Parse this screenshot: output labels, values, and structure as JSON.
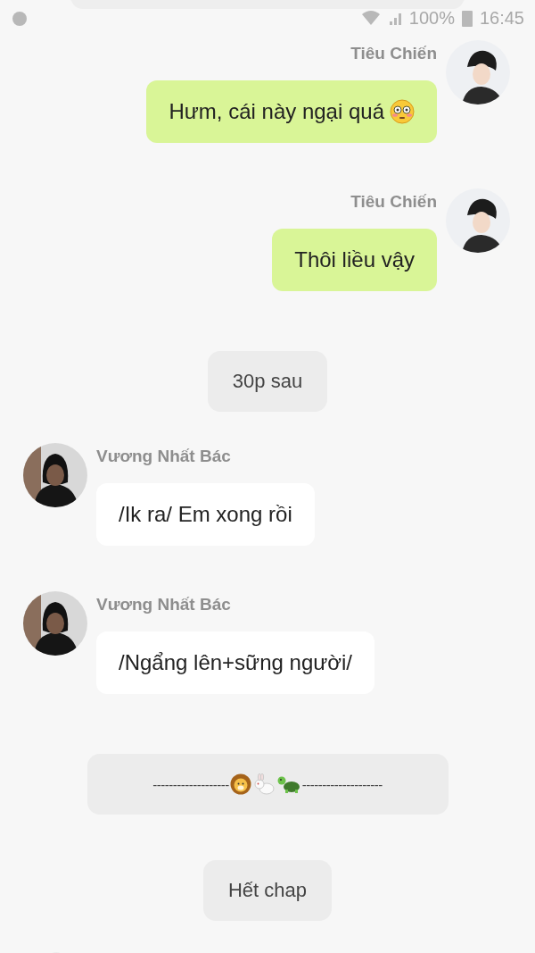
{
  "status_bar": {
    "battery": "100%",
    "time": "16:45"
  },
  "items": [
    {
      "kind": "sent",
      "sender": "Tiêu Chiến",
      "text": "Hưm, cái này ngại quá",
      "trailing_emoji": true
    },
    {
      "kind": "sent",
      "sender": "Tiêu Chiến",
      "text": "Thôi liều vậy",
      "trailing_emoji": false
    },
    {
      "kind": "notice",
      "text": "30p sau"
    },
    {
      "kind": "received",
      "sender": "Vương Nhất Bác",
      "text": "/Ik ra/ Em xong rồi",
      "trailing_emoji": false
    },
    {
      "kind": "received",
      "sender": "Vương Nhất Bác",
      "text": "/Ngẩng lên+sững người/",
      "trailing_emoji": false
    },
    {
      "kind": "divider",
      "left": "-------------------",
      "right": "--------------------"
    },
    {
      "kind": "notice",
      "text": "Hết chap"
    }
  ]
}
